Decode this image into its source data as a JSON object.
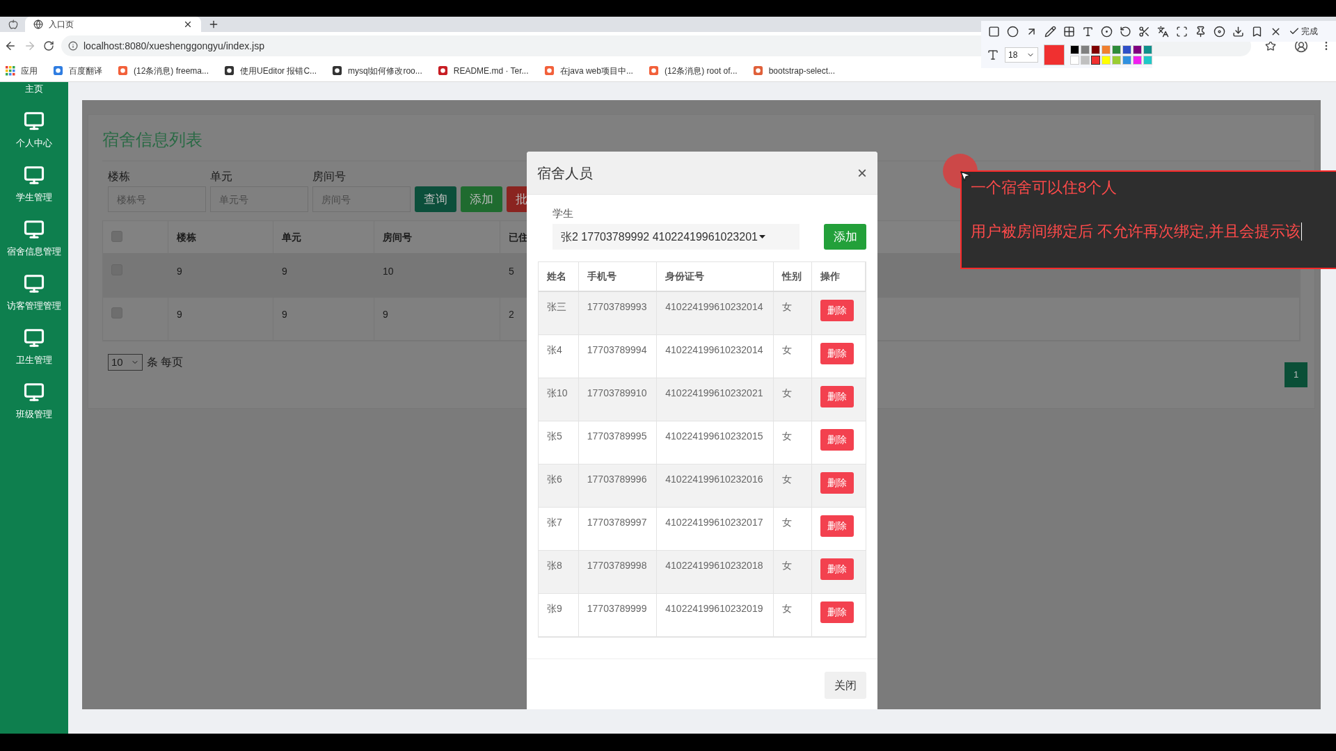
{
  "browser": {
    "tab_title": "入口页",
    "url": "localhost:8080/xueshenggongyu/index.jsp",
    "apps_label": "应用",
    "bookmarks": [
      {
        "label": "百度翻译",
        "color": "#2f7de1"
      },
      {
        "label": "(12条消息) freema...",
        "color": "#f2603a"
      },
      {
        "label": "使用UEditor 报错C...",
        "color": "#333333"
      },
      {
        "label": "mysql如何修改roo...",
        "color": "#333333"
      },
      {
        "label": "README.md · Ter...",
        "color": "#c71d23"
      },
      {
        "label": "在java web项目中...",
        "color": "#f2603a"
      },
      {
        "label": "(12条消息) root of...",
        "color": "#f2603a"
      },
      {
        "label": "bootstrap-select...",
        "color": "#e0603a"
      }
    ]
  },
  "screenshot_tool": {
    "done_label": "完成",
    "font_size": "18",
    "palette": [
      {
        "color": "#000000",
        "selected": false
      },
      {
        "color": "#808080",
        "selected": false
      },
      {
        "color": "#800000",
        "selected": false
      },
      {
        "color": "#f08030",
        "selected": false
      },
      {
        "color": "#2e8b3a",
        "selected": false
      },
      {
        "color": "#3050c8",
        "selected": false
      },
      {
        "color": "#800080",
        "selected": false
      },
      {
        "color": "#10908c",
        "selected": false
      },
      {
        "color": "#ffffff",
        "selected": false
      },
      {
        "color": "#c0c0c0",
        "selected": false
      },
      {
        "color": "#f03030",
        "selected": true
      },
      {
        "color": "#ffff00",
        "selected": false
      },
      {
        "color": "#9acd32",
        "selected": false
      },
      {
        "color": "#3090e0",
        "selected": false
      },
      {
        "color": "#f020f0",
        "selected": false
      },
      {
        "color": "#20c8c8",
        "selected": false
      }
    ]
  },
  "sidebar": {
    "items": [
      {
        "label": "主页"
      },
      {
        "label": "个人中心"
      },
      {
        "label": "学生管理"
      },
      {
        "label": "宿舍信息管理"
      },
      {
        "label": "访客管理管理"
      },
      {
        "label": "卫生管理"
      },
      {
        "label": "班级管理"
      }
    ]
  },
  "page": {
    "title": "宿舍信息列表",
    "filters": [
      {
        "label": "楼栋",
        "placeholder": "楼栋号"
      },
      {
        "label": "单元",
        "placeholder": "单元号"
      },
      {
        "label": "房间号",
        "placeholder": "房间号"
      }
    ],
    "buttons": [
      {
        "label": "查询",
        "kind": "query"
      },
      {
        "label": "添加",
        "kind": "add"
      },
      {
        "label": "批",
        "kind": "batch"
      }
    ],
    "table": {
      "header_checked": false,
      "columns": [
        "楼栋",
        "单元",
        "房间号",
        "已住"
      ],
      "rows": [
        {
          "checked": false,
          "cells": [
            "9",
            "9",
            "10",
            "5"
          ]
        },
        {
          "checked": false,
          "cells": [
            "9",
            "9",
            "9",
            "2"
          ]
        }
      ]
    },
    "page_size": "10",
    "page_size_label": "条 每页",
    "pages": [
      {
        "label": "1",
        "selected": true
      }
    ]
  },
  "modal": {
    "title": "宿舍人员",
    "close_symbol": "×",
    "student_label": "学生",
    "student_value": "张2 17703789992 41022419961023201",
    "add_label": "添加",
    "columns": [
      "姓名",
      "手机号",
      "身份证号",
      "性别",
      "操作"
    ],
    "rows": [
      {
        "name": "张三",
        "phone": "17703789993",
        "id_number": "410224199610232014",
        "gender": "女",
        "action": "删除"
      },
      {
        "name": "张4",
        "phone": "17703789994",
        "id_number": "410224199610232014",
        "gender": "女",
        "action": "删除"
      },
      {
        "name": "张10",
        "phone": "17703789910",
        "id_number": "410224199610232021",
        "gender": "女",
        "action": "删除"
      },
      {
        "name": "张5",
        "phone": "17703789995",
        "id_number": "410224199610232015",
        "gender": "女",
        "action": "删除"
      },
      {
        "name": "张6",
        "phone": "17703789996",
        "id_number": "410224199610232016",
        "gender": "女",
        "action": "删除"
      },
      {
        "name": "张7",
        "phone": "17703789997",
        "id_number": "410224199610232017",
        "gender": "女",
        "action": "删除"
      },
      {
        "name": "张8",
        "phone": "17703789998",
        "id_number": "410224199610232018",
        "gender": "女",
        "action": "删除"
      },
      {
        "name": "张9",
        "phone": "17703789999",
        "id_number": "410224199610232019",
        "gender": "女",
        "action": "删除"
      }
    ],
    "close_label": "关闭"
  },
  "annotation": {
    "lines": [
      "一个宿舍可以住8个人",
      "用户被房间绑定后 不允许再次绑定,并且会提示该"
    ]
  }
}
